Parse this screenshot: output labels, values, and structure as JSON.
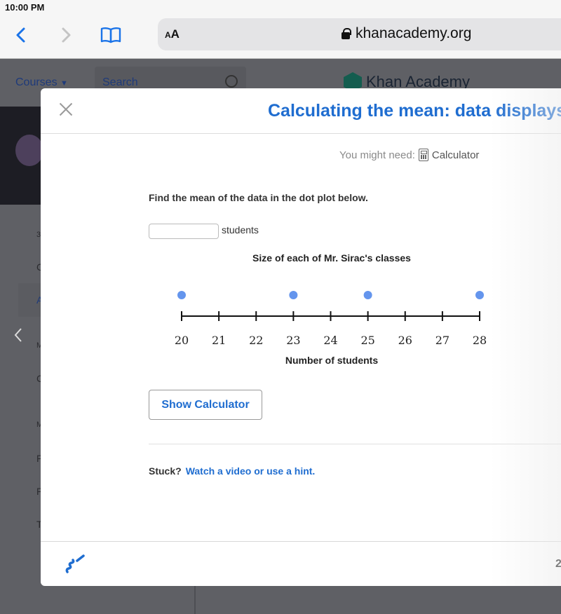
{
  "status_bar": {
    "time": "10:00 PM"
  },
  "browser": {
    "aa_label_small": "A",
    "aa_label_large": "A",
    "url": "khanacademy.org"
  },
  "site_header": {
    "courses_label": "Courses",
    "search_placeholder": "Search",
    "logo_text": "Khan Academy"
  },
  "sidebar": {
    "items": [
      {
        "label": "3"
      },
      {
        "label": "C"
      },
      {
        "label": "A"
      },
      {
        "label": "M"
      },
      {
        "label": "C"
      },
      {
        "label": "M"
      },
      {
        "label": "P"
      },
      {
        "label": "P"
      },
      {
        "label": "T"
      }
    ]
  },
  "modal": {
    "title": "Calculating the mean: data displays",
    "might_need_label": "You might need:",
    "calculator_label": "Calculator",
    "question": "Find the mean of the data in the dot plot below.",
    "answer_value": "",
    "answer_unit": "students",
    "show_calculator_label": "Show Calculator",
    "stuck_label": "Stuck?",
    "hint_link": "Watch a video or use a hint.",
    "progress_partial": "2"
  },
  "chart_data": {
    "type": "scatter",
    "title": "Size of each of Mr. Sirac's classes",
    "xlabel": "Number of students",
    "ylabel": "",
    "xlim": [
      20,
      28
    ],
    "ticks": [
      20,
      21,
      22,
      23,
      24,
      25,
      26,
      27,
      28
    ],
    "points": [
      {
        "x": 20,
        "count": 1
      },
      {
        "x": 23,
        "count": 1
      },
      {
        "x": 25,
        "count": 1
      },
      {
        "x": 28,
        "count": 1
      }
    ],
    "dot_color": "#6495ed",
    "grid": false
  }
}
